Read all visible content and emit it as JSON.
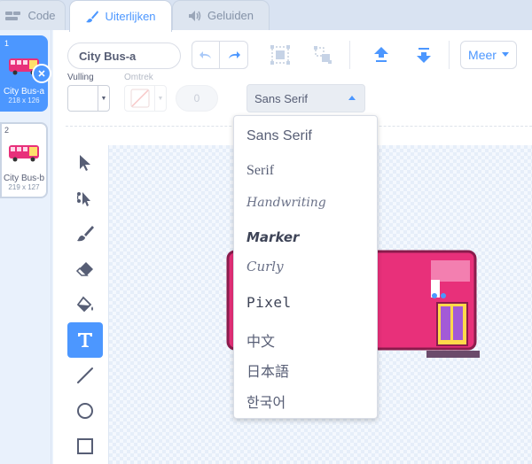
{
  "tabs": [
    {
      "label": "Code",
      "icon": "code-icon"
    },
    {
      "label": "Uiterlijken",
      "icon": "brush-icon"
    },
    {
      "label": "Geluiden",
      "icon": "speaker-icon"
    }
  ],
  "costumes": [
    {
      "index": "1",
      "name": "City Bus-a",
      "size": "218 x 126"
    },
    {
      "index": "2",
      "name": "City Bus-b",
      "size": "219 x 127"
    }
  ],
  "editor": {
    "costume_name": "City Bus-a",
    "more_label": "Meer",
    "fill_label": "Vulling",
    "outline_label": "Omtrek",
    "outline_width": "0",
    "font_selected": "Sans Serif"
  },
  "font_menu": [
    {
      "label": "Sans Serif"
    },
    {
      "label": "Serif"
    },
    {
      "label": "Handwriting"
    },
    {
      "label": "Marker"
    },
    {
      "label": "Curly"
    },
    {
      "label": "Pixel"
    },
    {
      "label": "中文"
    },
    {
      "label": "日本語"
    },
    {
      "label": "한국어"
    }
  ],
  "colors": {
    "accent": "#4c97ff",
    "text": "#575e75",
    "bus_pink": "#e8307a"
  }
}
